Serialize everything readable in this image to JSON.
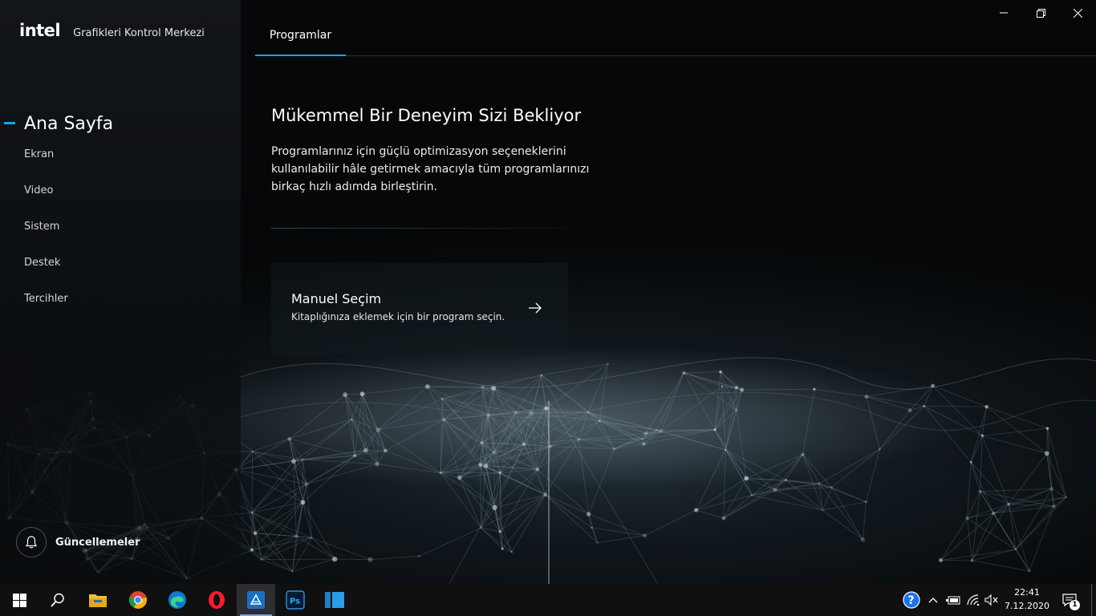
{
  "app": {
    "brand_logo": "intel",
    "title": "Grafikleri Kontrol Merkezi"
  },
  "sidebar": {
    "active_item": "Ana Sayfa",
    "items": [
      "Ekran",
      "Video",
      "Sistem",
      "Destek",
      "Tercihler"
    ],
    "updates_label": "Güncellemeler"
  },
  "tabs": [
    {
      "label": "Programlar",
      "active": true
    }
  ],
  "hero": {
    "title": "Mükemmel Bir Deneyim Sizi Bekliyor",
    "text": "Programlarınız için güçlü optimizasyon seçeneklerini kullanılabilir hâle getirmek amacıyla tüm programlarınızı birkaç hızlı adımda birleştirin."
  },
  "card": {
    "title": "Manuel Seçim",
    "subtitle": "Kitaplığınıza eklemek için bir program seçin."
  },
  "taskbar": {
    "apps": [
      "windows-start",
      "search",
      "file-explorer",
      "chrome",
      "edge",
      "opera",
      "intel-graphics",
      "photoshop",
      "app-blue"
    ],
    "active_app": "intel-graphics",
    "clock_time": "22:41",
    "clock_date": "7.12.2020",
    "notification_count": "1"
  },
  "colors": {
    "accent": "#00aeef",
    "sidebar_bg": "#121519",
    "taskbar_bg": "#101010"
  }
}
